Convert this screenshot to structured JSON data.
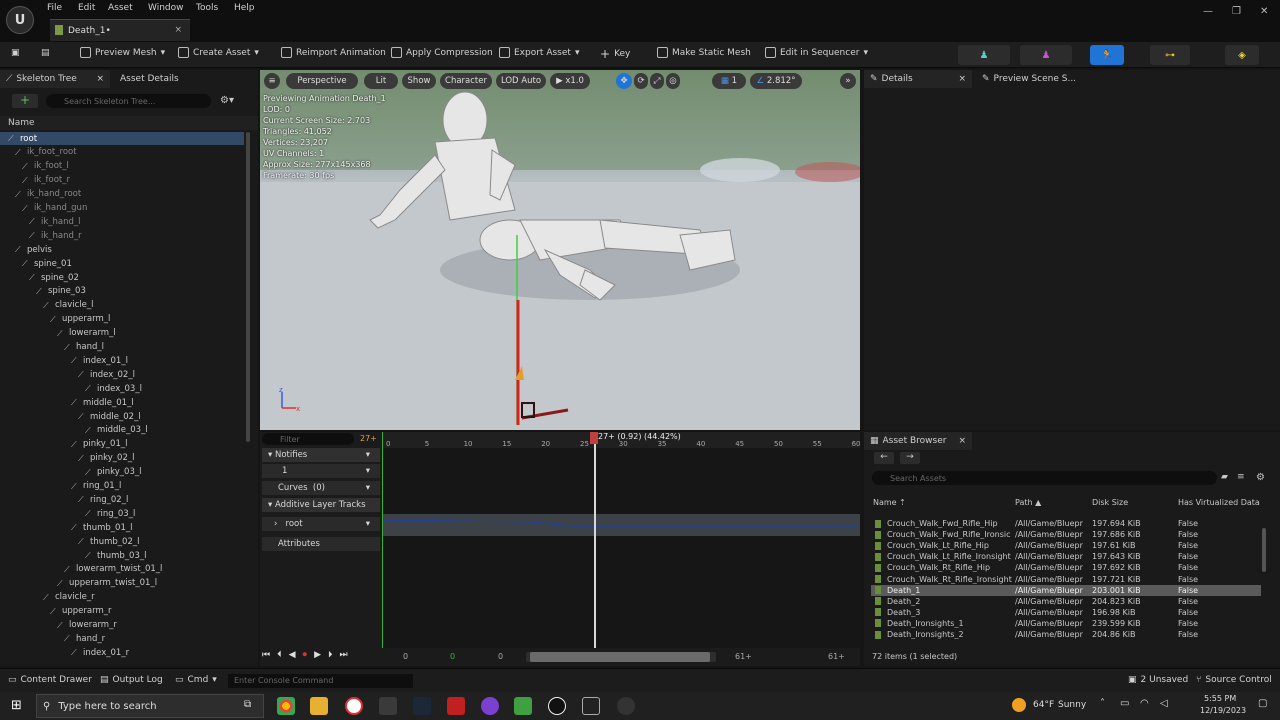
{
  "menu": {
    "items": [
      "File",
      "Edit",
      "Asset",
      "Window",
      "Tools",
      "Help"
    ],
    "logo": "U"
  },
  "document_tab": {
    "label": "Death_1•",
    "close": "×"
  },
  "toolbar": {
    "items": [
      "Preview Mesh",
      "Create Asset",
      "Reimport Animation",
      "Apply Compression",
      "Export Asset",
      "Key",
      "Make Static Mesh",
      "Edit in Sequencer"
    ]
  },
  "left_panel": {
    "tab1": "Skeleton Tree",
    "tab2": "Asset Details",
    "close": "×",
    "search_placeholder": "Search Skeleton Tree...",
    "column": "Name",
    "bones": [
      {
        "name": "root",
        "depth": 0
      },
      {
        "name": "ik_foot_root",
        "depth": 1
      },
      {
        "name": "ik_foot_l",
        "depth": 2
      },
      {
        "name": "ik_foot_r",
        "depth": 2
      },
      {
        "name": "ik_hand_root",
        "depth": 1
      },
      {
        "name": "ik_hand_gun",
        "depth": 2
      },
      {
        "name": "ik_hand_l",
        "depth": 3
      },
      {
        "name": "ik_hand_r",
        "depth": 3
      },
      {
        "name": "pelvis",
        "depth": 1
      },
      {
        "name": "spine_01",
        "depth": 2
      },
      {
        "name": "spine_02",
        "depth": 3
      },
      {
        "name": "spine_03",
        "depth": 4
      },
      {
        "name": "clavicle_l",
        "depth": 5
      },
      {
        "name": "upperarm_l",
        "depth": 6
      },
      {
        "name": "lowerarm_l",
        "depth": 7
      },
      {
        "name": "hand_l",
        "depth": 8
      },
      {
        "name": "index_01_l",
        "depth": 9
      },
      {
        "name": "index_02_l",
        "depth": 10
      },
      {
        "name": "index_03_l",
        "depth": 11
      },
      {
        "name": "middle_01_l",
        "depth": 9
      },
      {
        "name": "middle_02_l",
        "depth": 10
      },
      {
        "name": "middle_03_l",
        "depth": 11
      },
      {
        "name": "pinky_01_l",
        "depth": 9
      },
      {
        "name": "pinky_02_l",
        "depth": 10
      },
      {
        "name": "pinky_03_l",
        "depth": 11
      },
      {
        "name": "ring_01_l",
        "depth": 9
      },
      {
        "name": "ring_02_l",
        "depth": 10
      },
      {
        "name": "ring_03_l",
        "depth": 11
      },
      {
        "name": "thumb_01_l",
        "depth": 9
      },
      {
        "name": "thumb_02_l",
        "depth": 10
      },
      {
        "name": "thumb_03_l",
        "depth": 11
      },
      {
        "name": "lowerarm_twist_01_l",
        "depth": 8
      },
      {
        "name": "upperarm_twist_01_l",
        "depth": 7
      },
      {
        "name": "clavicle_r",
        "depth": 5
      },
      {
        "name": "upperarm_r",
        "depth": 6
      },
      {
        "name": "lowerarm_r",
        "depth": 7
      },
      {
        "name": "hand_r",
        "depth": 8
      },
      {
        "name": "index_01_r",
        "depth": 9
      }
    ]
  },
  "viewport": {
    "perspective": "Perspective",
    "lit": "Lit",
    "show": "Show",
    "character": "Character",
    "lod": "LOD Auto",
    "speed": "x1.0",
    "grid": "1",
    "angle": "2.812°",
    "stats": [
      "Previewing Animation Death_1",
      "LOD: 0",
      "Current Screen Size: 2.703",
      "Triangles: 41,052",
      "Vertices: 23,207",
      "UV Channels: 1",
      "Approx Size: 277x145x368",
      "Framerate: 30 fps"
    ]
  },
  "timeline": {
    "filter": "Filter",
    "frame_badge": "27+",
    "playhead_label": "27+ (0.92) (44.42%)",
    "ticks": [
      "0",
      "5",
      "10",
      "15",
      "20",
      "25",
      "30",
      "35",
      "40",
      "45",
      "50",
      "55",
      "60"
    ],
    "notifies": "Notifies",
    "notify_track": "1",
    "curves": "Curves",
    "curves_count": "(0)",
    "additive": "Additive Layer Tracks",
    "root": "root",
    "attributes": "Attributes",
    "start": "0",
    "start2": "0",
    "current": "0",
    "end": "61+",
    "end2": "61+"
  },
  "details": {
    "tab1": "Details",
    "tab2": "Preview Scene S...",
    "close": "×"
  },
  "asset_browser": {
    "tab": "Asset Browser",
    "close": "×",
    "search_placeholder": "Search Assets",
    "columns": [
      "Name",
      "Path",
      "Disk Size",
      "Has Virtualized Data"
    ],
    "rows": [
      {
        "name": "Crouch_Walk_Fwd_Rifle_Hip",
        "path": "/All/Game/Bluepr",
        "size": "197.694 KiB",
        "virt": "False"
      },
      {
        "name": "Crouch_Walk_Fwd_Rifle_Ironsic",
        "path": "/All/Game/Bluepr",
        "size": "197.686 KiB",
        "virt": "False"
      },
      {
        "name": "Crouch_Walk_Lt_Rifle_Hip",
        "path": "/All/Game/Bluepr",
        "size": "197.61 KiB",
        "virt": "False"
      },
      {
        "name": "Crouch_Walk_Lt_Rifle_Ironsight",
        "path": "/All/Game/Bluepr",
        "size": "197.643 KiB",
        "virt": "False"
      },
      {
        "name": "Crouch_Walk_Rt_Rifle_Hip",
        "path": "/All/Game/Bluepr",
        "size": "197.692 KiB",
        "virt": "False"
      },
      {
        "name": "Crouch_Walk_Rt_Rifle_Ironsight",
        "path": "/All/Game/Bluepr",
        "size": "197.721 KiB",
        "virt": "False"
      },
      {
        "name": "Death_1",
        "path": "/All/Game/Bluepr",
        "size": "203.001 KiB",
        "virt": "False"
      },
      {
        "name": "Death_2",
        "path": "/All/Game/Bluepr",
        "size": "204.823 KiB",
        "virt": "False"
      },
      {
        "name": "Death_3",
        "path": "/All/Game/Bluepr",
        "size": "196.98 KiB",
        "virt": "False"
      },
      {
        "name": "Death_Ironsights_1",
        "path": "/All/Game/Bluepr",
        "size": "239.599 KiB",
        "virt": "False"
      },
      {
        "name": "Death_Ironsights_2",
        "path": "/All/Game/Bluepr",
        "size": "204.86 KiB",
        "virt": "False"
      }
    ],
    "footer": "72 items (1 selected)"
  },
  "bottom": {
    "content_drawer": "Content Drawer",
    "output_log": "Output Log",
    "cmd": "Cmd",
    "console_placeholder": "Enter Console Command",
    "unsaved": "2 Unsaved",
    "source_control": "Source Control"
  },
  "taskbar": {
    "search": "Type here to search",
    "weather_temp": "64°F",
    "weather": "Sunny",
    "time": "5:55 PM",
    "date": "12/19/2023"
  }
}
